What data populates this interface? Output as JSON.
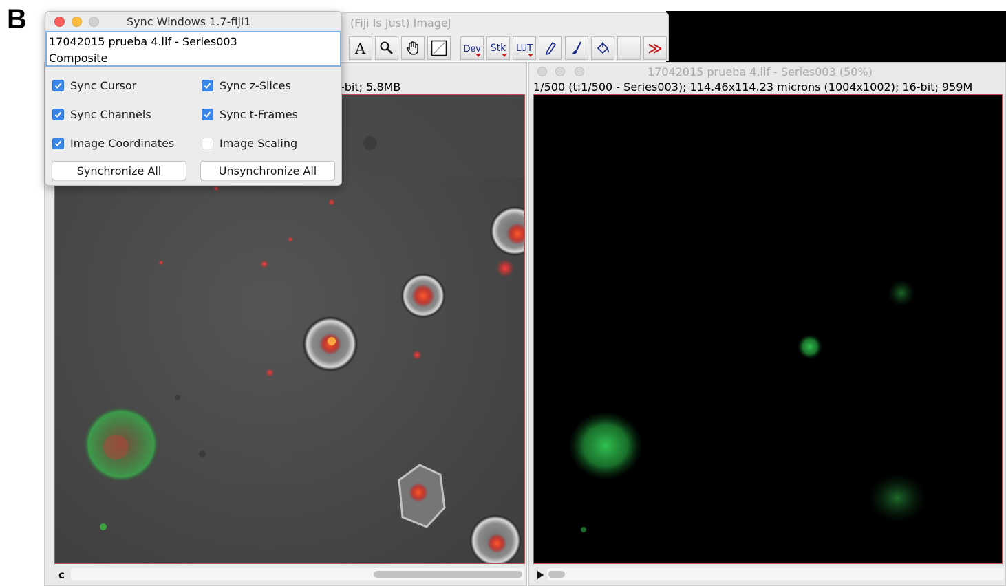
{
  "panel_letter": "B",
  "imagej_window": {
    "title": "(Fiji Is Just) ImageJ",
    "toolbar": {
      "tools": [
        {
          "name": "text-tool-icon"
        },
        {
          "name": "magnifier-tool-icon"
        },
        {
          "name": "hand-tool-icon"
        },
        {
          "name": "color-picker-tool-icon"
        },
        {
          "name": "dev-menu",
          "label": "Dev"
        },
        {
          "name": "stk-menu",
          "label": "Stk"
        },
        {
          "name": "lut-menu",
          "label": "LUT"
        },
        {
          "name": "pencil-tool-icon"
        },
        {
          "name": "brush-tool-icon"
        },
        {
          "name": "flood-fill-tool-icon"
        },
        {
          "name": "more-tools-icon",
          "label": "≫"
        }
      ]
    }
  },
  "sync_window": {
    "title": "Sync Windows 1.7-fiji1",
    "image_list": [
      "17042015 prueba 4.lif - Series003",
      "Composite"
    ],
    "options": [
      {
        "label": "Sync Cursor",
        "checked": true
      },
      {
        "label": "Sync z-Slices",
        "checked": true
      },
      {
        "label": "Sync Channels",
        "checked": true
      },
      {
        "label": "Sync t-Frames",
        "checked": true
      },
      {
        "label": "Image Coordinates",
        "checked": true
      },
      {
        "label": "Image Scaling",
        "checked": false
      }
    ],
    "buttons": {
      "synchronize": "Synchronize All",
      "unsynchronize": "Unsynchronize All"
    }
  },
  "left_window": {
    "info_fragment": "-bit; 5.8MB",
    "channel_label": "c"
  },
  "right_window": {
    "title": "17042015 prueba 4.lif - Series003 (50%)",
    "info": "1/500 (t:1/500 - Series003); 114.46x114.23 microns (1004x1002); 16-bit; 959M"
  },
  "colors": {
    "accent_blue": "#3a86e8",
    "close": "#fc605c",
    "minimize": "#fdbc40",
    "fluor_red": "#ff3030",
    "fluor_green": "#30d060"
  }
}
